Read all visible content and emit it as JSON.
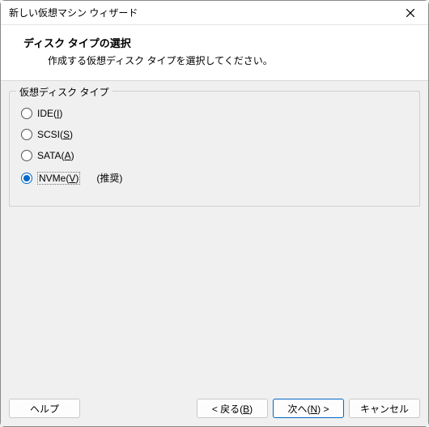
{
  "window": {
    "title": "新しい仮想マシン ウィザード"
  },
  "header": {
    "title": "ディスク タイプの選択",
    "subtitle": "作成する仮想ディスク タイプを選択してください。"
  },
  "group": {
    "legend": "仮想ディスク タイプ",
    "options": [
      {
        "label_prefix": "IDE(",
        "mnemonic": "I",
        "label_suffix": ")",
        "selected": false,
        "note": ""
      },
      {
        "label_prefix": "SCSI(",
        "mnemonic": "S",
        "label_suffix": ")",
        "selected": false,
        "note": ""
      },
      {
        "label_prefix": "SATA(",
        "mnemonic": "A",
        "label_suffix": ")",
        "selected": false,
        "note": ""
      },
      {
        "label_prefix": "NVMe(",
        "mnemonic": "V",
        "label_suffix": ")",
        "selected": true,
        "note": "(推奨)"
      }
    ]
  },
  "buttons": {
    "help": "ヘルプ",
    "back_prefix": "< 戻る(",
    "back_mnemonic": "B",
    "back_suffix": ")",
    "next_prefix": "次へ(",
    "next_mnemonic": "N",
    "next_suffix": ") >",
    "cancel": "キャンセル"
  }
}
